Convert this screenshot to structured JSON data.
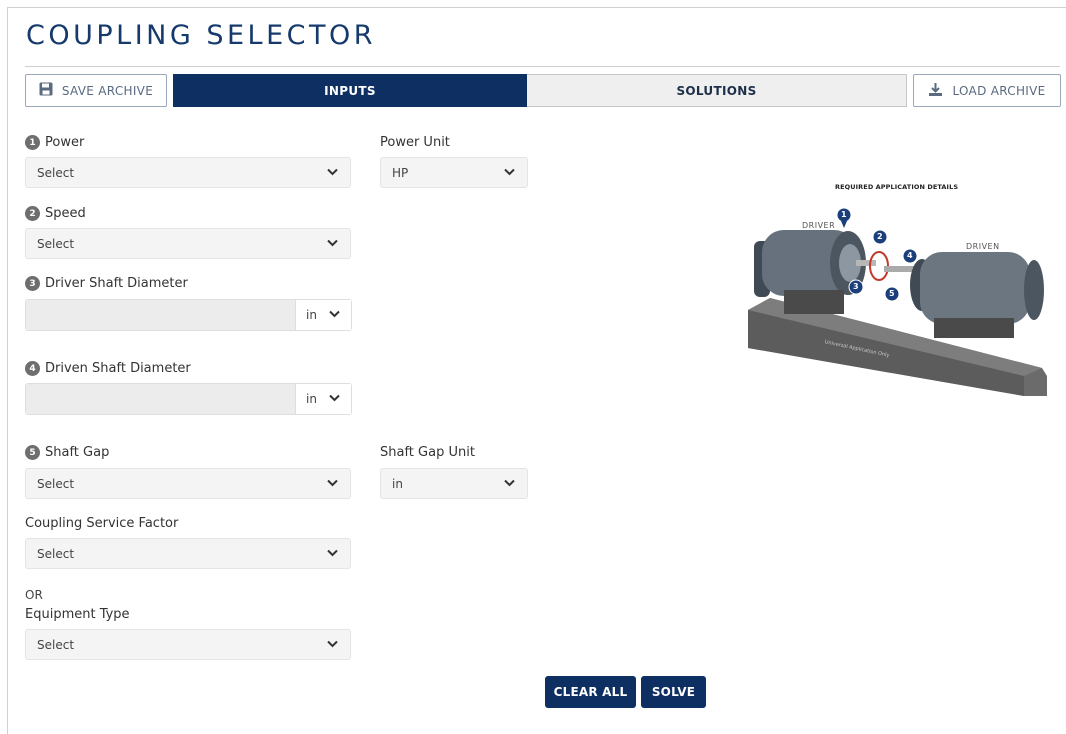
{
  "page": {
    "title": "COUPLING SELECTOR"
  },
  "toolbar": {
    "save_label": "SAVE ARCHIVE",
    "load_label": "LOAD ARCHIVE",
    "tabs": [
      {
        "label": "INPUTS",
        "active": true
      },
      {
        "label": "SOLUTIONS",
        "active": false
      }
    ]
  },
  "form": {
    "power": {
      "number": "1",
      "label": "Power",
      "value": "Select"
    },
    "power_unit": {
      "label": "Power Unit",
      "value": "HP"
    },
    "speed": {
      "number": "2",
      "label": "Speed",
      "value": "Select"
    },
    "driver_shaft": {
      "number": "3",
      "label": "Driver Shaft Diameter",
      "value": "",
      "unit": "in"
    },
    "driven_shaft": {
      "number": "4",
      "label": "Driven Shaft Diameter",
      "value": "",
      "unit": "in"
    },
    "shaft_gap": {
      "number": "5",
      "label": "Shaft Gap",
      "value": "Select"
    },
    "shaft_gap_unit": {
      "label": "Shaft Gap Unit",
      "value": "in"
    },
    "service_factor": {
      "label": "Coupling Service Factor",
      "value": "Select"
    },
    "or_text": "OR",
    "equipment_type": {
      "label": "Equipment Type",
      "value": "Select"
    }
  },
  "actions": {
    "clear_label": "CLEAR ALL",
    "solve_label": "SOLVE"
  },
  "diagram": {
    "title": "REQUIRED APPLICATION DETAILS",
    "driver_label": "DRIVER",
    "driven_label": "DRIVEN",
    "base_text": "Universal Application Only",
    "markers": [
      "1",
      "2",
      "3",
      "4",
      "5"
    ]
  },
  "colors": {
    "primary": "#0d2f62",
    "title": "#163a6b",
    "field_bg": "#f4f4f4",
    "coupling_red": "#c0392b"
  },
  "icons": {
    "save": "floppy-disk-icon",
    "load": "download-icon",
    "dropdown": "chevron-down-icon"
  }
}
